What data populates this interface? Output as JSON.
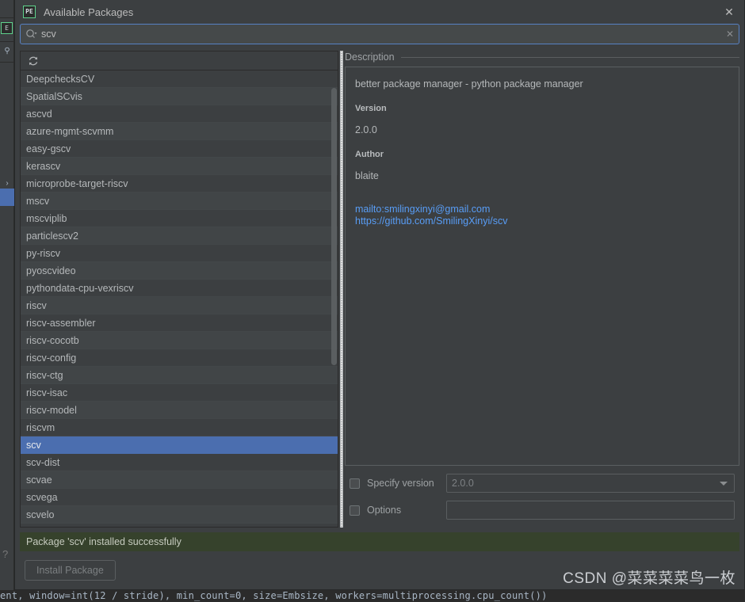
{
  "dialog": {
    "title": "Available Packages",
    "app_icon_label": "PE",
    "close_label": "✕"
  },
  "search": {
    "value": "scv",
    "placeholder": "",
    "icon": "search-icon",
    "clear_label": "✕"
  },
  "list_toolbar": {
    "refresh_icon": "refresh-icon"
  },
  "packages": [
    "DeepchecksCV",
    "SpatialSCvis",
    "ascvd",
    "azure-mgmt-scvmm",
    "easy-gscv",
    "kerascv",
    "microprobe-target-riscv",
    "mscv",
    "mscviplib",
    "particlescv2",
    "py-riscv",
    "pyoscvideo",
    "pythondata-cpu-vexriscv",
    "riscv",
    "riscv-assembler",
    "riscv-cocotb",
    "riscv-config",
    "riscv-ctg",
    "riscv-isac",
    "riscv-model",
    "riscvm",
    "scv",
    "scv-dist",
    "scvae",
    "scvega",
    "scvelo"
  ],
  "selected_package": "scv",
  "description": {
    "legend": "Description",
    "summary": "better package manager - python package manager",
    "version_label": "Version",
    "version_value": "2.0.0",
    "author_label": "Author",
    "author_value": "blaite",
    "links": [
      "mailto:smilingxinyi@gmail.com",
      "https://github.com/SmilingXinyi/scv"
    ]
  },
  "options": {
    "specify_version_label": "Specify version",
    "specify_version_value": "2.0.0",
    "specify_version_checked": false,
    "options_label": "Options",
    "options_value": "",
    "options_checked": false
  },
  "status": {
    "message": "Package 'scv' installed successfully"
  },
  "footer": {
    "install_label": "Install Package"
  },
  "watermark": {
    "text": "CSDN @菜菜菜菜鸟一枚"
  },
  "editor": {
    "code_line": "ent, window=int(12 / stride), min_count=0, size=Embsize, workers=multiprocessing.cpu_count())"
  },
  "colors": {
    "accent_selection": "#4b6eaf",
    "status_success_bg": "#36422c",
    "link": "#589df6",
    "panel_bg": "#3c3f41",
    "focus_border": "#5781c4"
  }
}
